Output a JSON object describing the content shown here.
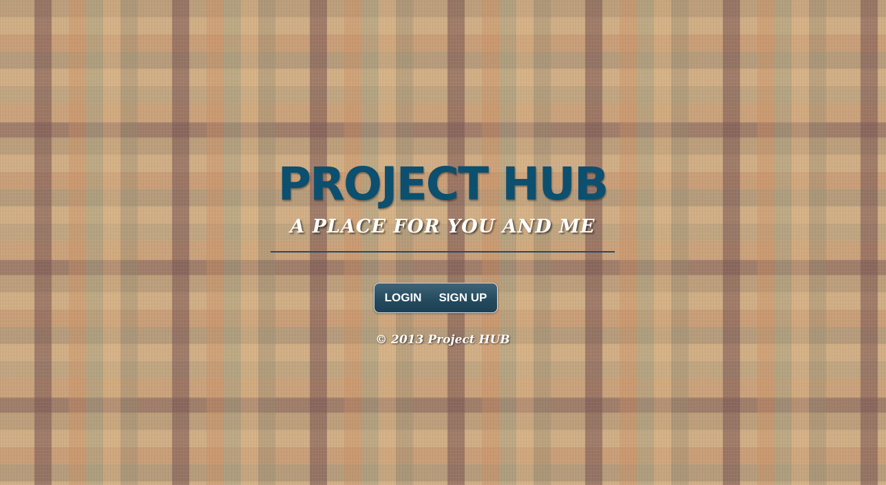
{
  "header": {
    "title": "PROJECT HUB",
    "tagline": "A PLACE FOR YOU AND ME"
  },
  "nav": {
    "login_label": "LOGIN",
    "signup_label": "SIGN UP"
  },
  "footer": {
    "copyright": "© 2013 Project HUB"
  },
  "colors": {
    "title": "#0d4f6e",
    "divider": "#1e4a66",
    "nav_background": "#254b5f",
    "text_light": "#ffffff"
  }
}
